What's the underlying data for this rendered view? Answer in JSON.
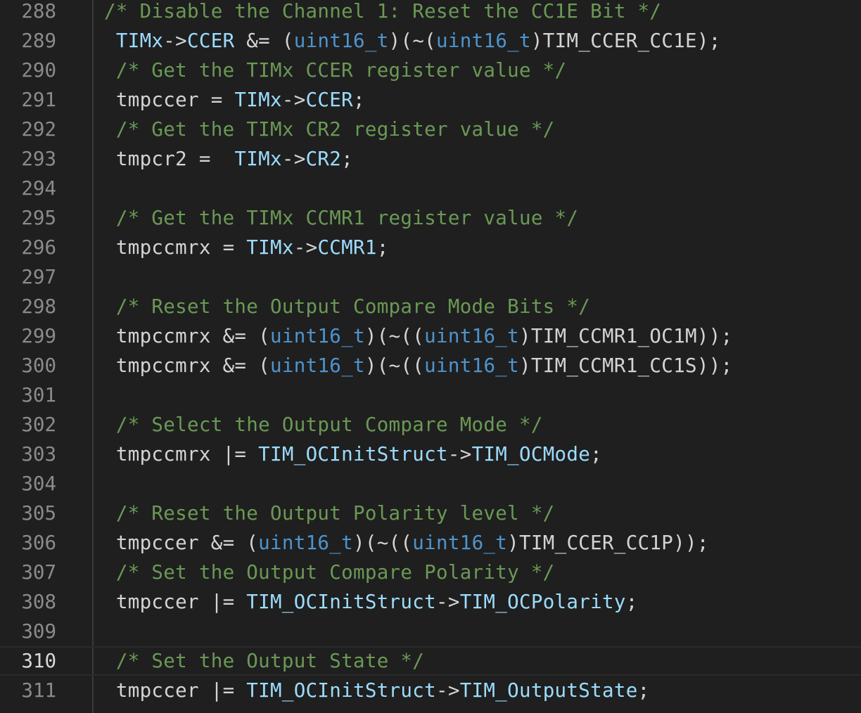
{
  "editor": {
    "current_line": 310,
    "colors": {
      "background": "#1f1f1f",
      "comment": "#6a9955",
      "variable": "#9cdcfe",
      "type": "#4e94ce",
      "plain": "#d4d4d4",
      "line_number": "#8b8b8b"
    },
    "lines": [
      {
        "num": "288",
        "tokens": [
          {
            "t": "/* Disable the Channel 1: Reset the CC1E Bit */",
            "k": "comment"
          }
        ]
      },
      {
        "num": "289",
        "tokens": [
          {
            "t": " ",
            "k": "plain"
          },
          {
            "t": "TIMx",
            "k": "var"
          },
          {
            "t": "->",
            "k": "plain"
          },
          {
            "t": "CCER",
            "k": "var"
          },
          {
            "t": " &= (",
            "k": "plain"
          },
          {
            "t": "uint16_t",
            "k": "type"
          },
          {
            "t": ")(~(",
            "k": "plain"
          },
          {
            "t": "uint16_t",
            "k": "type"
          },
          {
            "t": ")TIM_CCER_CC1E);",
            "k": "plain"
          }
        ]
      },
      {
        "num": "290",
        "tokens": [
          {
            "t": " /* Get the TIMx CCER register value */",
            "k": "comment"
          }
        ]
      },
      {
        "num": "291",
        "tokens": [
          {
            "t": " tmpccer = ",
            "k": "plain"
          },
          {
            "t": "TIMx",
            "k": "var"
          },
          {
            "t": "->",
            "k": "plain"
          },
          {
            "t": "CCER",
            "k": "var"
          },
          {
            "t": ";",
            "k": "plain"
          }
        ]
      },
      {
        "num": "292",
        "tokens": [
          {
            "t": " /* Get the TIMx CR2 register value */",
            "k": "comment"
          }
        ]
      },
      {
        "num": "293",
        "tokens": [
          {
            "t": " tmpcr2 =  ",
            "k": "plain"
          },
          {
            "t": "TIMx",
            "k": "var"
          },
          {
            "t": "->",
            "k": "plain"
          },
          {
            "t": "CR2",
            "k": "var"
          },
          {
            "t": ";",
            "k": "plain"
          }
        ]
      },
      {
        "num": "294",
        "tokens": []
      },
      {
        "num": "295",
        "tokens": [
          {
            "t": " /* Get the TIMx CCMR1 register value */",
            "k": "comment"
          }
        ]
      },
      {
        "num": "296",
        "tokens": [
          {
            "t": " tmpccmrx = ",
            "k": "plain"
          },
          {
            "t": "TIMx",
            "k": "var"
          },
          {
            "t": "->",
            "k": "plain"
          },
          {
            "t": "CCMR1",
            "k": "var"
          },
          {
            "t": ";",
            "k": "plain"
          }
        ]
      },
      {
        "num": "297",
        "tokens": []
      },
      {
        "num": "298",
        "tokens": [
          {
            "t": " /* Reset the Output Compare Mode Bits */",
            "k": "comment"
          }
        ]
      },
      {
        "num": "299",
        "tokens": [
          {
            "t": " tmpccmrx &= (",
            "k": "plain"
          },
          {
            "t": "uint16_t",
            "k": "type"
          },
          {
            "t": ")(~((",
            "k": "plain"
          },
          {
            "t": "uint16_t",
            "k": "type"
          },
          {
            "t": ")TIM_CCMR1_OC1M));",
            "k": "plain"
          }
        ]
      },
      {
        "num": "300",
        "tokens": [
          {
            "t": " tmpccmrx &= (",
            "k": "plain"
          },
          {
            "t": "uint16_t",
            "k": "type"
          },
          {
            "t": ")(~((",
            "k": "plain"
          },
          {
            "t": "uint16_t",
            "k": "type"
          },
          {
            "t": ")TIM_CCMR1_CC1S));",
            "k": "plain"
          }
        ]
      },
      {
        "num": "301",
        "tokens": []
      },
      {
        "num": "302",
        "tokens": [
          {
            "t": " /* Select the Output Compare Mode */",
            "k": "comment"
          }
        ]
      },
      {
        "num": "303",
        "tokens": [
          {
            "t": " tmpccmrx |= ",
            "k": "plain"
          },
          {
            "t": "TIM_OCInitStruct",
            "k": "var"
          },
          {
            "t": "->",
            "k": "plain"
          },
          {
            "t": "TIM_OCMode",
            "k": "var"
          },
          {
            "t": ";",
            "k": "plain"
          }
        ]
      },
      {
        "num": "304",
        "tokens": []
      },
      {
        "num": "305",
        "tokens": [
          {
            "t": " /* Reset the Output Polarity level */",
            "k": "comment"
          }
        ]
      },
      {
        "num": "306",
        "tokens": [
          {
            "t": " tmpccer &= (",
            "k": "plain"
          },
          {
            "t": "uint16_t",
            "k": "type"
          },
          {
            "t": ")(~((",
            "k": "plain"
          },
          {
            "t": "uint16_t",
            "k": "type"
          },
          {
            "t": ")TIM_CCER_CC1P));",
            "k": "plain"
          }
        ]
      },
      {
        "num": "307",
        "tokens": [
          {
            "t": " /* Set the Output Compare Polarity */",
            "k": "comment"
          }
        ]
      },
      {
        "num": "308",
        "tokens": [
          {
            "t": " tmpccer |= ",
            "k": "plain"
          },
          {
            "t": "TIM_OCInitStruct",
            "k": "var"
          },
          {
            "t": "->",
            "k": "plain"
          },
          {
            "t": "TIM_OCPolarity",
            "k": "var"
          },
          {
            "t": ";",
            "k": "plain"
          }
        ]
      },
      {
        "num": "309",
        "tokens": []
      },
      {
        "num": "310",
        "tokens": [
          {
            "t": " /* Set the Output State */",
            "k": "comment"
          }
        ]
      },
      {
        "num": "311",
        "tokens": [
          {
            "t": " tmpccer |= ",
            "k": "plain"
          },
          {
            "t": "TIM_OCInitStruct",
            "k": "var"
          },
          {
            "t": "->",
            "k": "plain"
          },
          {
            "t": "TIM_OutputState",
            "k": "var"
          },
          {
            "t": ";",
            "k": "plain"
          }
        ]
      }
    ]
  }
}
